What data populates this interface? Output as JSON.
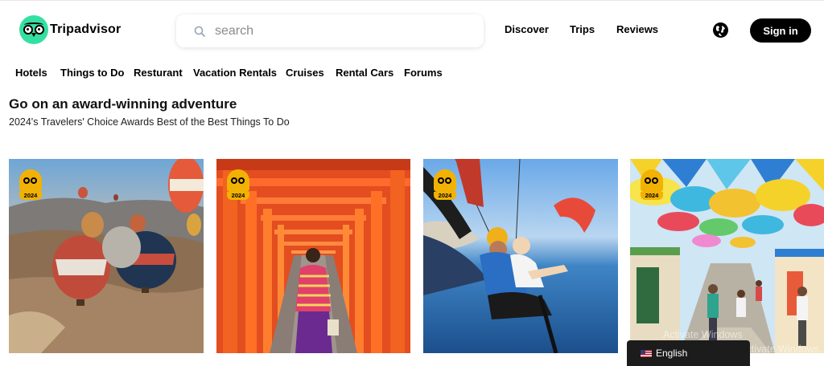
{
  "brand": {
    "name": "Tripadvisor",
    "accent": "#34e0a1"
  },
  "search": {
    "placeholder": "search"
  },
  "header_nav": [
    {
      "label": "Discover"
    },
    {
      "label": "Trips"
    },
    {
      "label": "Reviews"
    }
  ],
  "globe_icon": "globe-icon",
  "signin": {
    "label": "Sign in"
  },
  "categories": [
    {
      "label": "Hotels"
    },
    {
      "label": "Things to Do"
    },
    {
      "label": "Resturant"
    },
    {
      "label": "Vacation Rentals"
    },
    {
      "label": "Cruises"
    },
    {
      "label": "Rental Cars"
    },
    {
      "label": "Forums"
    }
  ],
  "section": {
    "title": "Go on an award-winning adventure",
    "subtitle": "2024's Travelers' Choice Awards Best of the Best Things To Do"
  },
  "cards": [
    {
      "badge_year": "2024"
    },
    {
      "badge_year": "2024"
    },
    {
      "badge_year": "2024"
    },
    {
      "badge_year": "2024"
    }
  ],
  "award_color": "#f2b203",
  "os_overlay": {
    "watermark_line1": "Activate Windows",
    "watermark_line2": "Go to Settings to activate Windows."
  },
  "language": {
    "label": "English"
  }
}
